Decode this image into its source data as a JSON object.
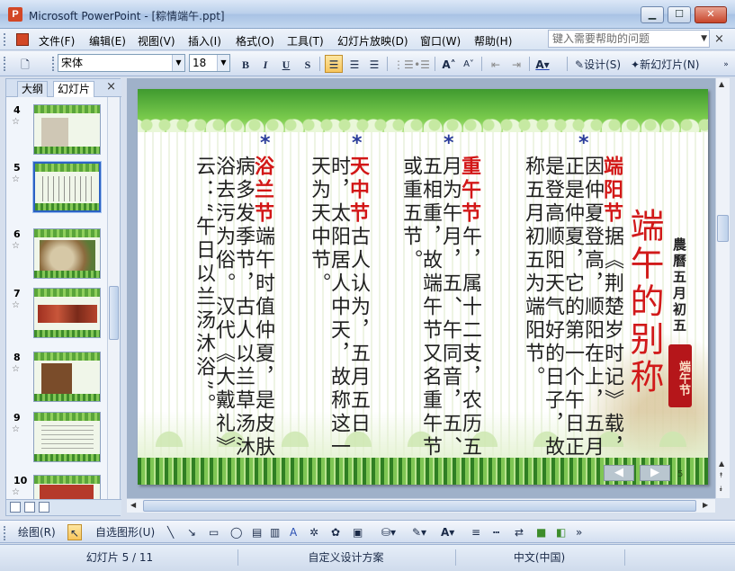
{
  "window": {
    "app_icon_letter": "P",
    "title": "Microsoft PowerPoint - [粽情端午.ppt]",
    "controls": {
      "minimize": "▁",
      "maximize": "☐",
      "close": "✕"
    }
  },
  "menu": {
    "items": [
      "文件(F)",
      "编辑(E)",
      "视图(V)",
      "插入(I)",
      "格式(O)",
      "工具(T)",
      "幻灯片放映(D)",
      "窗口(W)",
      "帮助(H)"
    ],
    "help_placeholder": "键入需要帮助的问题",
    "close_glyph": "×"
  },
  "toolbar": {
    "font_name": "宋体",
    "font_size": "18",
    "bold": "B",
    "italic": "I",
    "underline": "U",
    "shadow": "S",
    "design_label": "设计(S)",
    "new_slide_label": "新幻灯片(N)"
  },
  "left_pane": {
    "tab_outline": "大纲",
    "tab_slides": "幻灯片",
    "close_glyph": "×",
    "thumbnails": [
      {
        "num": "4",
        "selected": false
      },
      {
        "num": "5",
        "selected": true
      },
      {
        "num": "6",
        "selected": false
      },
      {
        "num": "7",
        "selected": false
      },
      {
        "num": "8",
        "selected": false
      },
      {
        "num": "9",
        "selected": false
      },
      {
        "num": "10",
        "selected": false
      }
    ]
  },
  "slide": {
    "title": "端午的别称",
    "subtitle": "農曆五月初五",
    "seal": "端午节",
    "star": "*",
    "columns": [
      {
        "red": "端阳节",
        "text": "据《荆楚岁时记》载，因仲夏登高，顺阳在上，五月正是仲夏，它的第一个午日正是登高顺阳天气好的日子，故称五月初五为端阳节。"
      },
      {
        "red": "重午节",
        "text": "午，属十二支，农历五月为午月，五、午同音，五、五相重，故端午节又名重午节或重五节。"
      },
      {
        "red": "天中节",
        "text": "古人认为，五月五日时，太阳居人中天，故称这一天为天中节。"
      },
      {
        "red": "浴兰节",
        "text": "端午时值仲夏，是皮肤病多发季节，古人以兰草汤沐浴去污为俗。汉代《大戴礼》云：“午日以兰汤沐浴”。"
      }
    ],
    "page_num": "5",
    "nav_prev": "◀",
    "nav_next": "▶"
  },
  "drawbar": {
    "draw_label": "绘图(R)",
    "autoshapes_label": "自选图形(U)"
  },
  "status": {
    "slide_info": "幻灯片 5 / 11",
    "design": "自定义设计方案",
    "language": "中文(中国)"
  }
}
